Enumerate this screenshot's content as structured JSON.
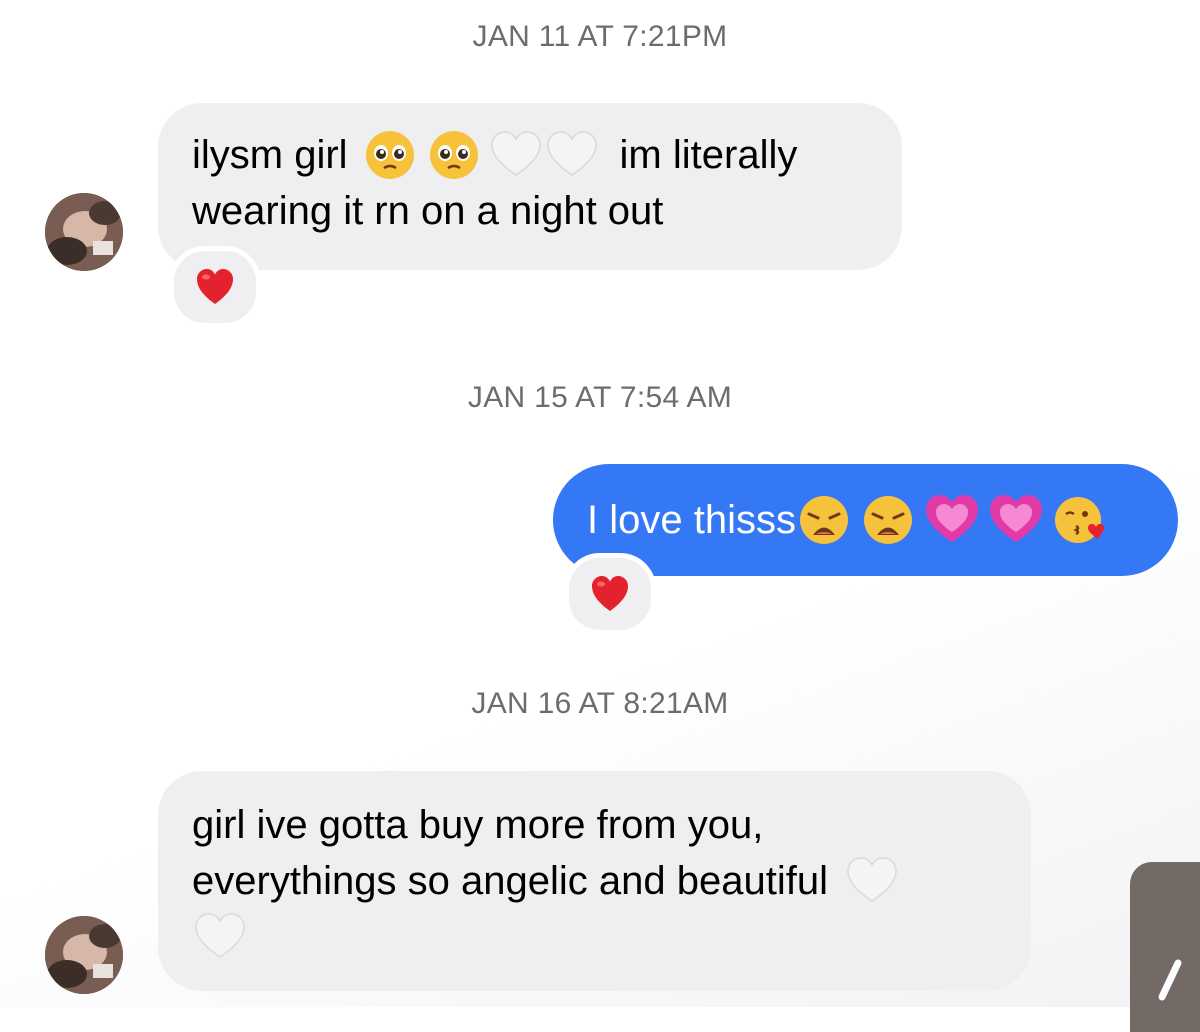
{
  "conversation": {
    "timestamps": [
      "JAN 11 AT 7:21PM",
      "JAN 15 AT 7:54 AM",
      "JAN 16 AT 8:21AM"
    ],
    "messages": [
      {
        "direction": "incoming",
        "line1_text_a": "ilysm girl",
        "line1_emojis": [
          "pleading-face",
          "pleading-face",
          "white-heart",
          "white-heart"
        ],
        "line1_text_b": "im literally",
        "line2_text": "wearing it rn on a night out",
        "reaction": "red-heart"
      },
      {
        "direction": "outgoing",
        "text": "I love thisss",
        "emojis": [
          "weary-face",
          "weary-face",
          "growing-heart",
          "growing-heart",
          "face-blowing-kiss"
        ],
        "reaction": "red-heart"
      },
      {
        "direction": "incoming",
        "line1_text": "girl ive gotta buy more from you,",
        "line2_text": "everythings so angelic and beautiful",
        "line2_emojis": [
          "white-heart"
        ],
        "line3_emojis": [
          "white-heart"
        ]
      }
    ]
  },
  "colors": {
    "incoming_bubble": "#efeff1",
    "outgoing_bubble": "#3478f6",
    "timestamp_text": "#6c6c70",
    "reaction_heart": "#e3222d"
  }
}
